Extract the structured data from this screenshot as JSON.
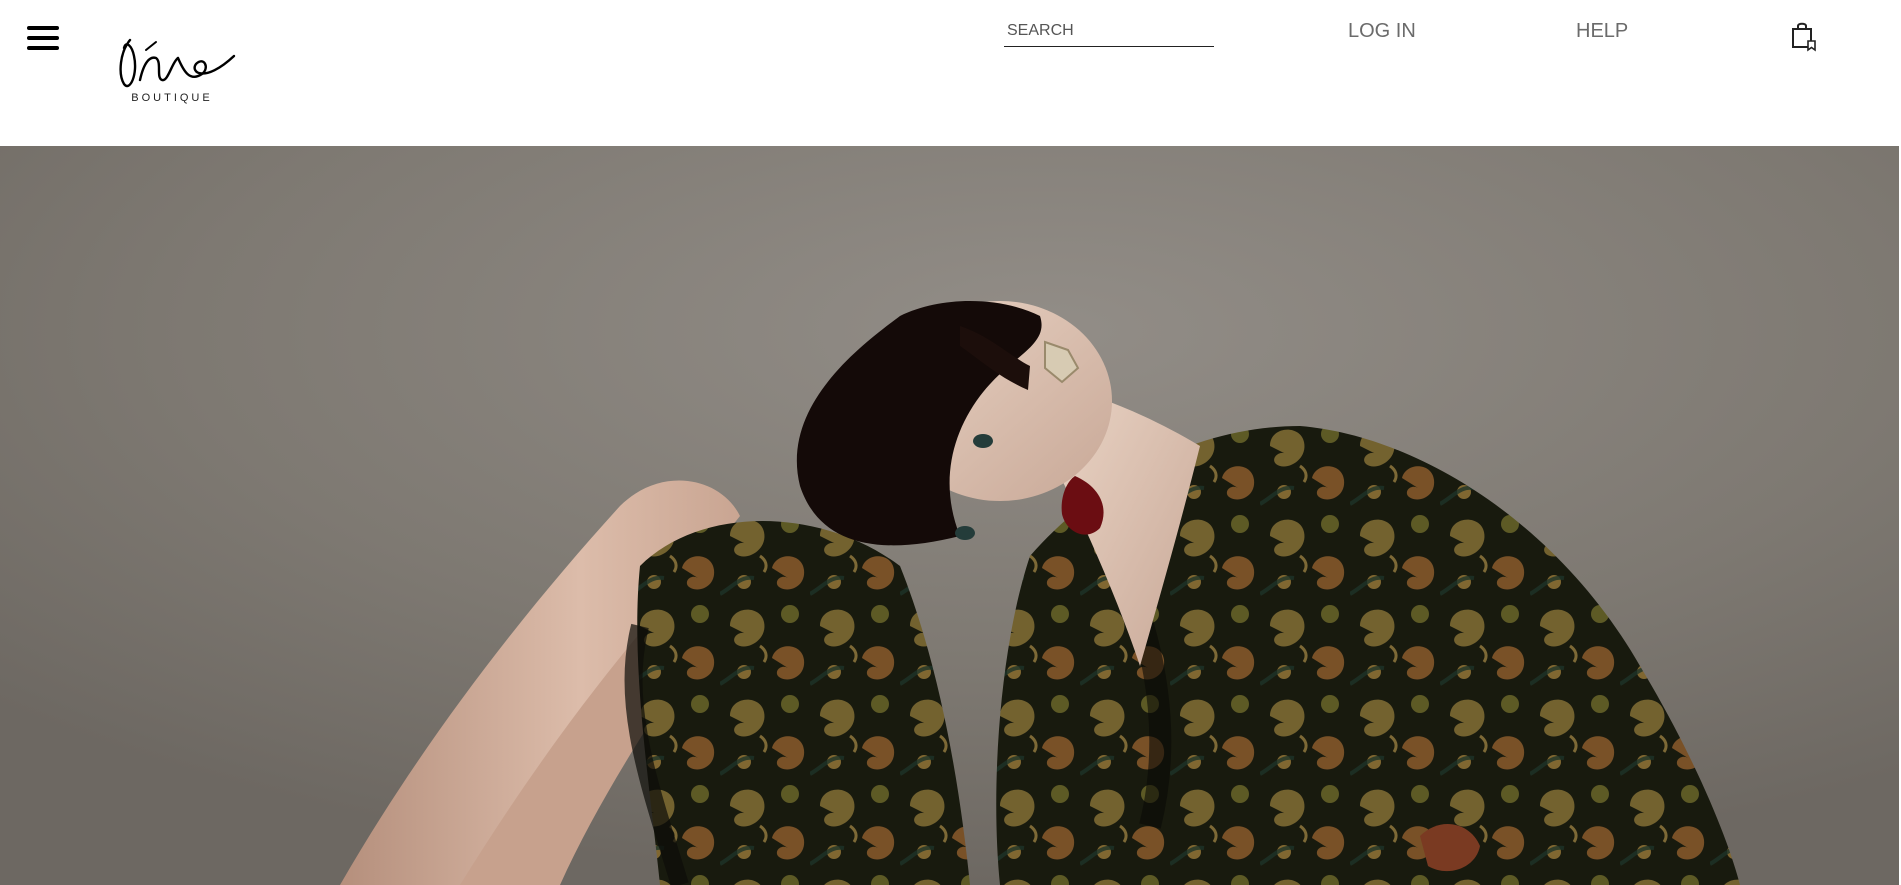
{
  "header": {
    "menu_icon": "hamburger-menu-icon",
    "logo": {
      "script_text": "one",
      "subtitle": "BOUTIQUE"
    },
    "search": {
      "placeholder": "SEARCH",
      "value": ""
    },
    "nav": {
      "login_label": "LOG IN",
      "help_label": "HELP"
    },
    "cart_icon": "shopping-bag-icon"
  },
  "hero": {
    "image": "fashion-model-paisley-velvet-dress"
  },
  "colors": {
    "header_bg": "#ffffff",
    "nav_text": "#6b6b6b",
    "hero_bg": "#7f7a73",
    "lipstick": "#6b0d12"
  }
}
